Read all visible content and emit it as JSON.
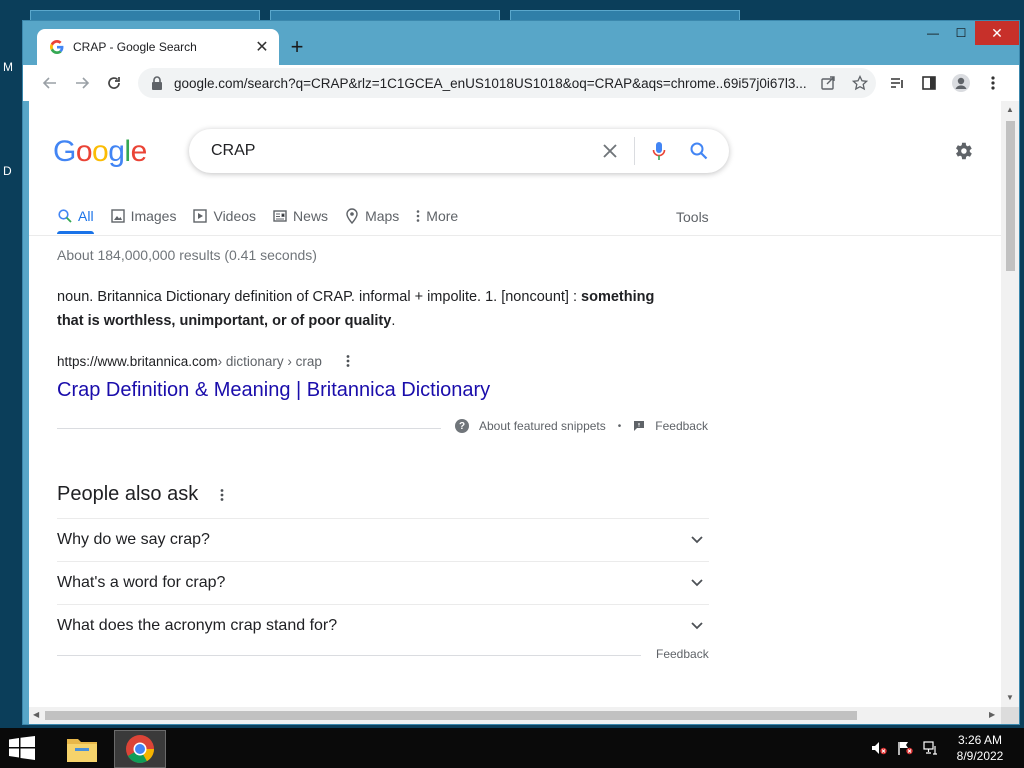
{
  "desktop": {
    "left_letters": [
      "M",
      "D"
    ]
  },
  "browser": {
    "tab": {
      "title": "CRAP - Google Search",
      "close_glyph": "✕"
    },
    "new_tab_glyph": "+",
    "window_controls": {
      "minimize": "—",
      "maximize": "☐",
      "close": "✕"
    },
    "address_bar": {
      "url": "google.com/search?q=CRAP&rlz=1C1GCEA_enUS1018US1018&oq=CRAP&aqs=chrome..69i57j0i67l3..."
    }
  },
  "google": {
    "logo_letters": [
      {
        "ch": "G",
        "color": "#4285F4"
      },
      {
        "ch": "o",
        "color": "#EA4335"
      },
      {
        "ch": "o",
        "color": "#FBBC05"
      },
      {
        "ch": "g",
        "color": "#4285F4"
      },
      {
        "ch": "l",
        "color": "#34A853"
      },
      {
        "ch": "e",
        "color": "#EA4335"
      }
    ],
    "query": "CRAP",
    "nav_tabs": [
      "All",
      "Images",
      "Videos",
      "News",
      "Maps",
      "More"
    ],
    "tools_label": "Tools",
    "stats": "About 184,000,000 results (0.41 seconds)",
    "featured_snippet": {
      "text": "noun. Britannica Dictionary definition of CRAP. informal + impolite. 1. [noncount] :",
      "bold": "something that is worthless, unimportant, or of poor quality",
      "tail": ".",
      "cite_domain": "https://www.britannica.com",
      "cite_path": " › dictionary › crap",
      "link_title": "Crap Definition & Meaning | Britannica Dictionary",
      "about_label": "About featured snippets",
      "feedback_label": "Feedback"
    },
    "people_also_ask": {
      "title": "People also ask",
      "questions": [
        "Why do we say crap?",
        "What's a word for crap?",
        "What does the acronym crap stand for?"
      ],
      "feedback_label": "Feedback"
    }
  },
  "taskbar": {
    "time": "3:26 AM",
    "date": "8/9/2022"
  }
}
